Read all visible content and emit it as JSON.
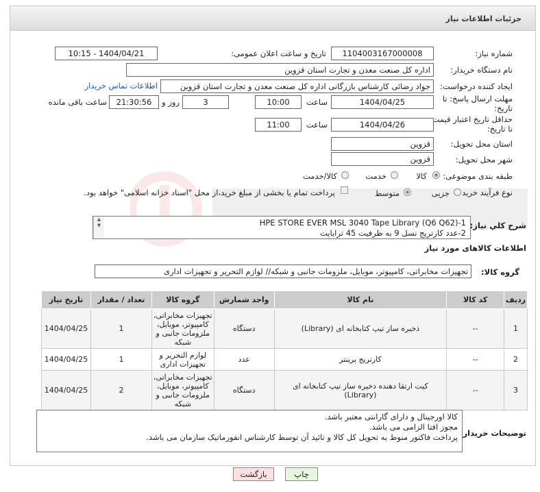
{
  "header": {
    "title": "جزئیات اطلاعات نیاز"
  },
  "need_number": {
    "label": "شماره نیاز:",
    "value": "1104003167000008"
  },
  "announce": {
    "label": "تاریخ و ساعت اعلان عمومی:",
    "value": "1404/04/21 - 10:15"
  },
  "buyer_org": {
    "label": "نام دستگاه خریدار:",
    "value": "اداره کل صنعت  معدن و تجارت استان قزوین"
  },
  "requester": {
    "label": "ایجاد کننده درخواست:",
    "value": "جواد رضائی کارشناس بازرگانی اداره کل صنعت  معدن و تجارت استان قزوین",
    "contact_link": "اطلاعات تماس خریدار"
  },
  "deadline": {
    "label_line1": "مهلت ارسال پاسخ: تا",
    "label_line2": "تاریخ:",
    "date": "1404/04/25",
    "time_label": "ساعت",
    "time": "10:00",
    "days": "3",
    "days_label": "روز و",
    "remaining": "21:30:56",
    "remaining_label": "ساعت باقی مانده"
  },
  "price_validity": {
    "label_line1": "حداقل تاریخ اعتبار قیمت:",
    "label_line2": "تا تاریخ:",
    "date": "1404/04/26",
    "time_label": "ساعت",
    "time": "11:00"
  },
  "delivery_province": {
    "label": "استان محل تحویل:",
    "value": "قزوین"
  },
  "delivery_city": {
    "label": "شهر محل تحویل:",
    "value": "قزوین"
  },
  "category": {
    "label": "طبقه بندی موضوعی:",
    "options": [
      "کالا",
      "خدمت",
      "کالا/خدمت"
    ],
    "selected": "کالا"
  },
  "process": {
    "label": "نوع فرآیند خرید :",
    "options": [
      "جزیی",
      "متوسط"
    ],
    "selected": "متوسط",
    "note": "پرداخت تمام یا بخشی از مبلغ خرید،از محل \"اسناد خزانه اسلامی\" خواهد بود."
  },
  "description": {
    "label": "شرح کلي نياز:",
    "lines": [
      "1-HPE STORE EVER MSL 3040 Tape Library (Q6 Q62)",
      "2-عدد کارتریج نسل 9  به ظرفیت 45 ترابایت"
    ]
  },
  "goods_info": {
    "title": "اطلاعات کالاهای مورد نیاز"
  },
  "goods_group": {
    "label": "گروه کالا:",
    "value": "تجهیزات مخابراتی، کامپیوتر، موبایل، ملزومات جانبی و شبکه// لوازم التحریر و تجهیزات اداری"
  },
  "table": {
    "headers": [
      "ردیف",
      "کد کالا",
      "نام کالا",
      "واحد شمارش",
      "گروه کالا",
      "تعداد / مقدار",
      "تاریخ نیاز"
    ],
    "rows": [
      [
        "1",
        "--",
        "ذخیره ساز تیپ کتابخانه ای (Library)",
        "دستگاه",
        "تجهیزات مخابراتی، کامپیوتر، موبایل، ملزومات جانبی و شبکه",
        "1",
        "1404/04/25"
      ],
      [
        "2",
        "--",
        "کارتریج پرینتر",
        "عدد",
        "لوازم التحریر و تجهیزات اداری",
        "1",
        "1404/04/25"
      ],
      [
        "3",
        "--",
        "کیت ارتقا دهنده ذخیره ساز تیپ کتابخانه ای (Library)",
        "دستگاه",
        "تجهیزات مخابراتی، کامپیوتر، موبایل، ملزومات جانبی و شبکه",
        "2",
        "1404/04/25"
      ]
    ]
  },
  "buyer_notes": {
    "label": "توضیحات خریدار:",
    "lines": [
      "کالا اورجینال و دارای گارانتی معتبر باشد.",
      "مجوز افتا الزامی می باشد.",
      "پرداخت فاکتور منوط به تحویل کل کالا و تائید آن توسط کارشناس انفورماتیک سازمان می باشد."
    ]
  },
  "buttons": {
    "print": "چاپ",
    "back": "بازگشت"
  },
  "colors": {
    "link": "#1a58c4",
    "header_bg": "#dcdcdc",
    "table_header": "#cccccc",
    "back_button": "#fde0e0",
    "print_button": "#e6f7e0"
  }
}
